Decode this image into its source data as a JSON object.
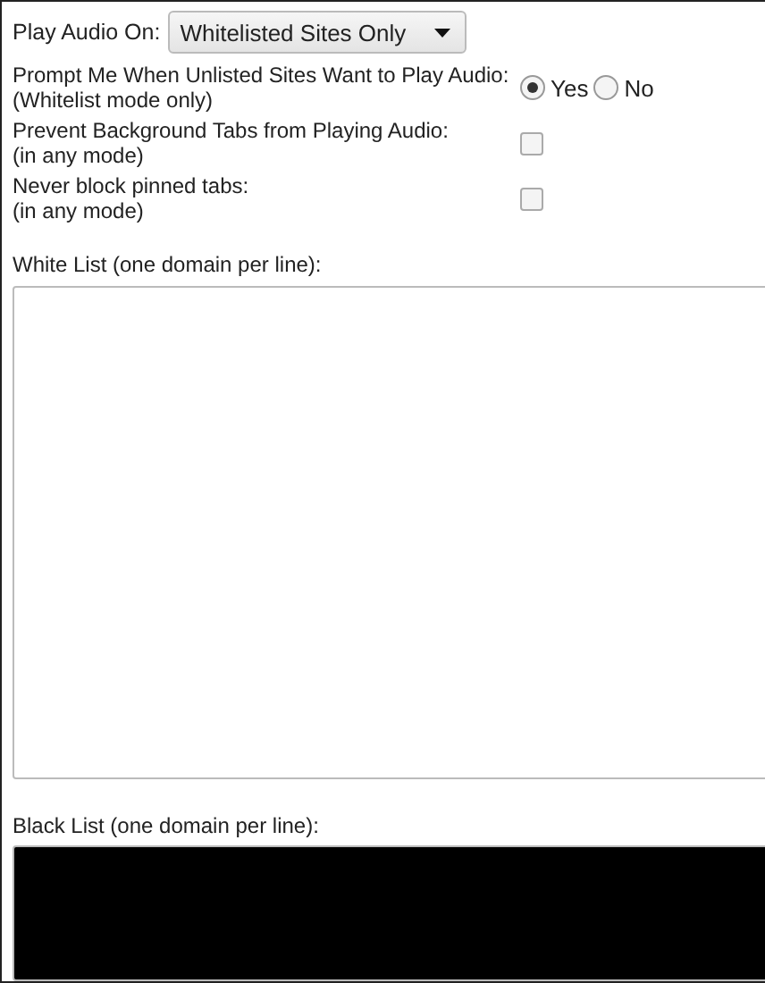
{
  "play_audio_on": {
    "label": "Play Audio On:",
    "value": "Whitelisted Sites Only"
  },
  "prompt": {
    "label": "Prompt Me When Unlisted Sites Want to Play Audio:",
    "note": "(Whitelist mode only)",
    "options": [
      {
        "label": "Yes",
        "selected": true
      },
      {
        "label": "No",
        "selected": false
      }
    ]
  },
  "options": [
    {
      "label": "Prevent Background Tabs from Playing Audio:",
      "note": "(in any mode)",
      "checked": false
    },
    {
      "label": "Never block pinned tabs:",
      "note": "(in any mode)",
      "checked": false
    }
  ],
  "white_list": {
    "label": "White List (one domain per line):"
  },
  "black_list": {
    "label": "Black List (one domain per line):"
  }
}
